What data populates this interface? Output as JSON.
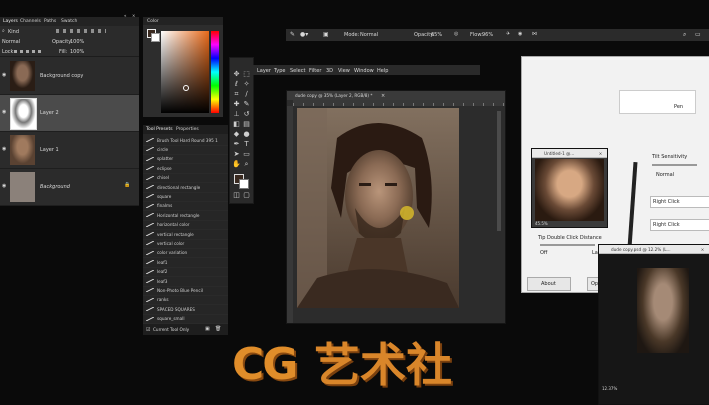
{
  "layers_panel": {
    "tabs": [
      "Layers",
      "Channels",
      "Paths",
      "Swatch"
    ],
    "kind_label": "Kind",
    "blend_mode": "Normal",
    "opacity_label": "Opacity:",
    "opacity_value": "100%",
    "lock_label": "Lock:",
    "fill_label": "Fill:",
    "fill_value": "100%",
    "layers": [
      {
        "name": "Background copy",
        "selected": false
      },
      {
        "name": "Layer 2",
        "selected": true
      },
      {
        "name": "Layer 1",
        "selected": false
      },
      {
        "name": "Background",
        "selected": false
      }
    ]
  },
  "color_panel": {
    "title": "Color",
    "foreground": "#3a2a20",
    "background": "#ffffff"
  },
  "tool_presets": {
    "tabs": [
      "Tool Presets",
      "Properties"
    ],
    "items": [
      "Brush Tool Hard Round 395 1",
      "circle",
      "splatter",
      "eclipse",
      "chisel",
      "directional rectangle",
      "square",
      "finalms",
      "Horizontal rectangle",
      "horizontal color",
      "vertical rectangle",
      "vertical color",
      "color variation",
      "leaf1",
      "leaf2",
      "leaf3",
      "Non-Photo Blue Pencil",
      "ranks",
      "SPACED SQUARES",
      "square_small"
    ],
    "footer_checkbox": "Current Tool Only"
  },
  "menu_bar": [
    "Layer",
    "Type",
    "Select",
    "Filter",
    "3D",
    "View",
    "Window",
    "Help"
  ],
  "options_bar": {
    "mode_label": "Mode:",
    "mode_value": "Normal",
    "opacity_label": "Opacity:",
    "opacity_value": "65%",
    "flow_label": "Flow:",
    "flow_value": "96%"
  },
  "document": {
    "tab_title": "dude copy @ 35% (Layer 2, RGB/8) *",
    "close": "×"
  },
  "ref_windows": [
    {
      "title": "dude copy @..."
    },
    {
      "title": "Untitled-1 @..."
    },
    {
      "title": "dude copy.psd @ 12.2% (L..."
    }
  ],
  "ref_zoom": [
    "45.5%",
    "12.37%"
  ],
  "tablet_dialog": {
    "pen_label": "Pen",
    "tilt_label": "Tilt Sensitivity",
    "normal_label": "Normal",
    "right_click_1": "Right Click",
    "right_click_2": "Right Click",
    "double_click_label": "Tip Double Click Distance",
    "off_label": "Off",
    "large_label": "Large",
    "about_button": "About",
    "options_button": "Opt"
  },
  "watermark": {
    "latin": "CG",
    "cjk": "艺术社"
  }
}
